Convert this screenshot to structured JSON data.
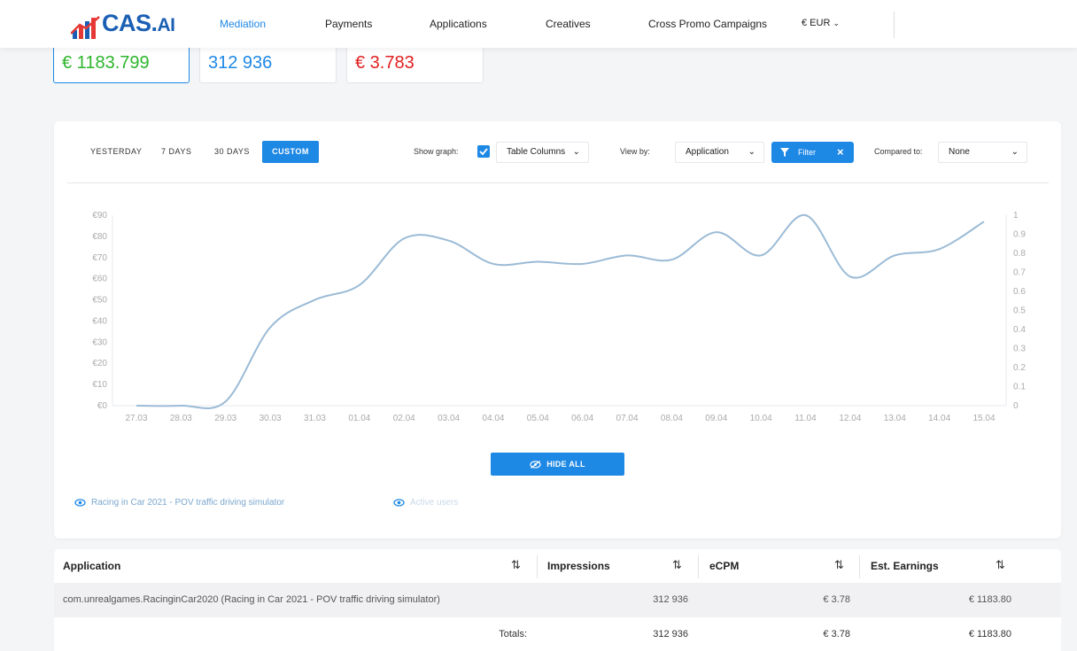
{
  "nav": {
    "logo_main": "CAS.",
    "logo_suffix": "AI",
    "items": [
      "Mediation",
      "Payments",
      "Applications",
      "Creatives",
      "Cross Promo Campaigns"
    ],
    "currency": "€ EUR"
  },
  "kpis": [
    {
      "value": "€ 1183.799",
      "color": "#2db52d"
    },
    {
      "value": "312 936",
      "color": "#1e88e5"
    },
    {
      "value": "€ 3.783",
      "color": "#e02020"
    }
  ],
  "controls": {
    "periods": [
      "YESTERDAY",
      "7 DAYS",
      "30 DAYS"
    ],
    "custom": "CUSTOM",
    "show_graph_label": "Show graph:",
    "table_columns": "Table Columns",
    "view_by_label": "View by:",
    "view_by_value": "Application",
    "filter": "Filter",
    "compared_to_label": "Compared to:",
    "compared_to_value": "None"
  },
  "chart_data": {
    "type": "line",
    "x": [
      "27.03",
      "28.03",
      "29.03",
      "30.03",
      "31.03",
      "01.04",
      "02.04",
      "03.04",
      "04.04",
      "05.04",
      "06.04",
      "07.04",
      "08.04",
      "09.04",
      "10.04",
      "11.04",
      "12.04",
      "13.04",
      "14.04",
      "15.04"
    ],
    "series": [
      {
        "name": "Racing in Car 2021 - POV traffic driving simulator",
        "color": "#9bbbd6",
        "values": [
          0,
          0,
          2,
          37,
          50,
          57,
          79,
          78,
          67,
          68,
          67,
          71,
          69,
          82,
          71,
          90,
          61,
          71,
          74,
          87
        ]
      }
    ],
    "y_left_ticks": [
      "€0",
      "€10",
      "€20",
      "€30",
      "€40",
      "€50",
      "€60",
      "€70",
      "€80",
      "€90"
    ],
    "y_right_ticks": [
      "0",
      "0.1",
      "0.2",
      "0.3",
      "0.4",
      "0.5",
      "0.6",
      "0.7",
      "0.8",
      "0.9",
      "1"
    ],
    "ylim": [
      0,
      90
    ],
    "y2lim": [
      0,
      1
    ]
  },
  "hide_all": "HIDE ALL",
  "legend": [
    {
      "label": "Racing in Car 2021 - POV traffic driving simulator",
      "color": "#7aa7cf"
    },
    {
      "label": "Active users",
      "color": "#c9d9e8"
    }
  ],
  "table": {
    "headers": [
      "Application",
      "Impressions",
      "eCPM",
      "Est. Earnings"
    ],
    "rows": [
      {
        "app": "com.unrealgames.RacinginCar2020 (Racing in Car 2021 - POV traffic driving simulator)",
        "impressions": "312 936",
        "ecpm": "€ 3.78",
        "earnings": "€ 1183.80"
      }
    ],
    "totals": {
      "label": "Totals:",
      "impressions": "312 936",
      "ecpm": "€ 3.78",
      "earnings": "€ 1183.80"
    }
  }
}
